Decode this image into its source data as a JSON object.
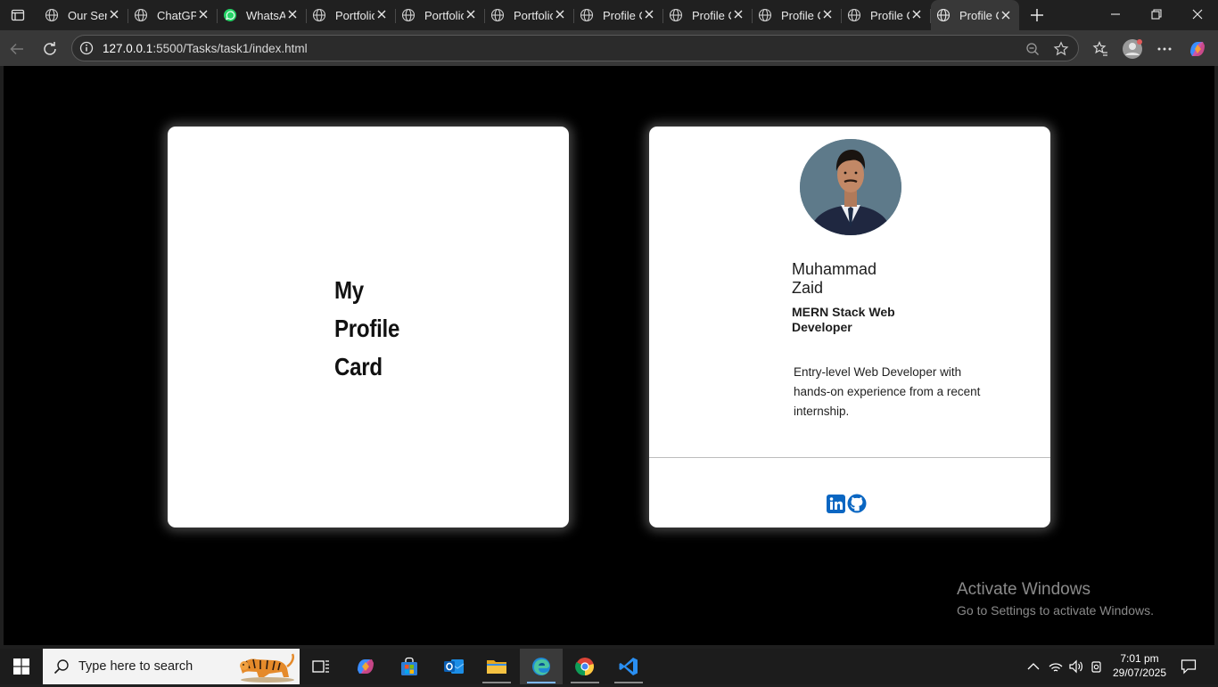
{
  "browser": {
    "tabs": [
      {
        "title": "Our Services",
        "icon": "globe-icon"
      },
      {
        "title": "ChatGPT",
        "icon": "globe-icon"
      },
      {
        "title": "WhatsApp",
        "icon": "whatsapp-icon"
      },
      {
        "title": "Portfolio",
        "icon": "globe-icon"
      },
      {
        "title": "Portfolio",
        "icon": "globe-icon"
      },
      {
        "title": "Portfolio",
        "icon": "globe-icon"
      },
      {
        "title": "Profile Card",
        "icon": "globe-icon"
      },
      {
        "title": "Profile Card",
        "icon": "globe-icon"
      },
      {
        "title": "Profile Card",
        "icon": "globe-icon"
      },
      {
        "title": "Profile Card",
        "icon": "globe-icon"
      },
      {
        "title": "Profile Card",
        "icon": "globe-icon",
        "active": true
      }
    ],
    "url_host": "127.0.0.1",
    "url_rest": ":5500/Tasks/task1/index.html"
  },
  "page": {
    "left_card_title_lines": [
      "My",
      "Profile",
      "Card"
    ],
    "profile": {
      "name_line1": "Muhammad",
      "name_line2": "Zaid",
      "role_line1": "MERN Stack Web",
      "role_line2": "Developer",
      "bio_line1": "Entry-level Web Developer with",
      "bio_line2": "hands-on experience from a recent",
      "bio_line3": "internship.",
      "social": [
        "linkedin-icon",
        "github-icon"
      ]
    },
    "accent_color": "#0a66c2"
  },
  "os": {
    "watermark_title": "Activate Windows",
    "watermark_sub": "Go to Settings to activate Windows.",
    "search_placeholder": "Type here to search",
    "time": "7:01 pm",
    "date": "29/07/2025"
  }
}
